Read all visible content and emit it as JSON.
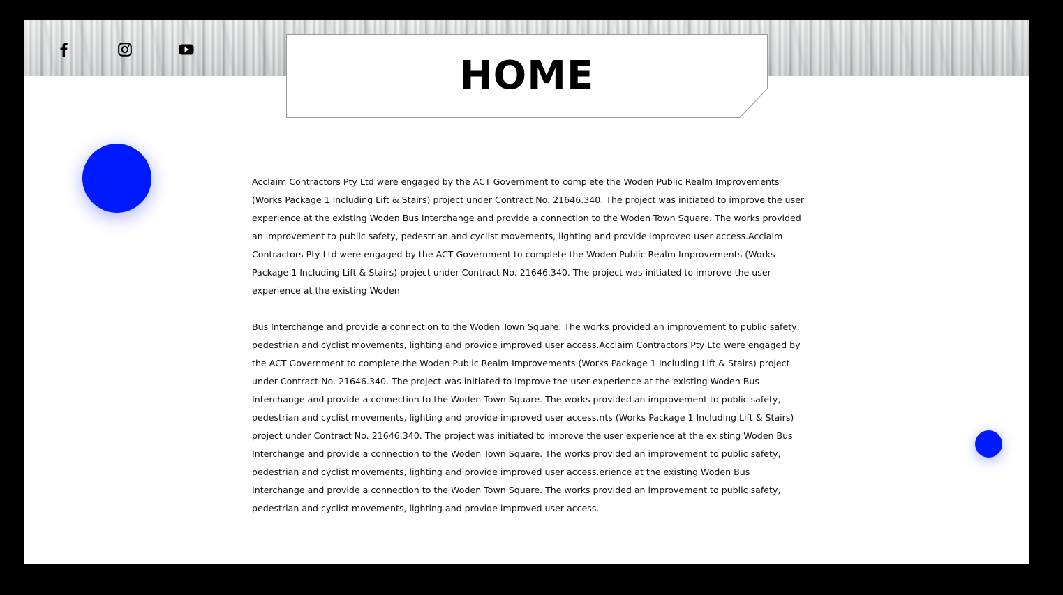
{
  "header": {
    "title": "HOME",
    "social": [
      {
        "icon": "facebook-icon",
        "label": "Facebook"
      },
      {
        "icon": "instagram-icon",
        "label": "Instagram"
      },
      {
        "icon": "youtube-icon",
        "label": "YouTube"
      }
    ]
  },
  "content": {
    "paragraphs": [
      "Acclaim Contractors Pty Ltd were engaged by the ACT Government to complete the Woden Public Realm Improvements (Works Package 1 Including Lift & Stairs) project under Contract No. 21646.340. The project was initiated to improve the user experience at the existing Woden Bus Interchange and provide a connection to the Woden Town Square. The works provided an improvement to public safety, pedestrian and cyclist movements, lighting and provide improved user access.Acclaim Contractors Pty Ltd were engaged by the ACT Government to complete the Woden Public Realm Improvements (Works Package 1 Including Lift & Stairs) project under Contract No. 21646.340. The project was initiated to improve the user experience at the existing Woden",
      "Bus Interchange and provide a connection to the Woden Town Square. The works provided an improvement to public safety, pedestrian and cyclist movements, lighting and provide improved user access.Acclaim Contractors Pty Ltd were engaged by the ACT Government to complete the Woden Public Realm Improvements (Works Package 1 Including Lift & Stairs) project under Contract No. 21646.340. The project was initiated to improve the user experience at the existing Woden Bus Interchange and provide a connection to the Woden Town Square. The works provided an improvement to public safety, pedestrian and cyclist movements, lighting and provide improved user access.nts (Works Package 1 Including Lift & Stairs) project under Contract No. 21646.340. The project was initiated to improve the user experience at the existing Woden Bus Interchange and provide a connection to the Woden Town Square. The works provided an improvement to public safety, pedestrian and cyclist movements, lighting and provide improved user access.erience at the existing Woden Bus Interchange and provide a connection to the Woden Town Square. The works provided an improvement to public safety, pedestrian and cyclist movements, lighting and provide improved user access."
    ]
  },
  "colors": {
    "accent": "#001aff",
    "background": "#ffffff",
    "frame": "#000000"
  }
}
